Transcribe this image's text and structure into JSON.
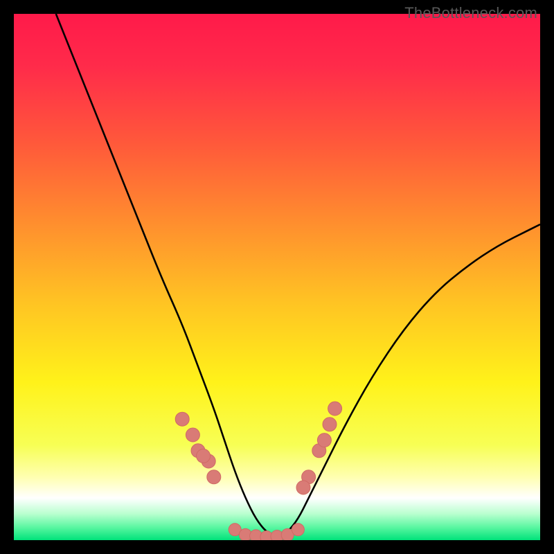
{
  "watermark": "TheBottleneck.com",
  "colors": {
    "gradient_stops": [
      {
        "offset": 0.0,
        "color": "#ff1a4a"
      },
      {
        "offset": 0.1,
        "color": "#ff2b4a"
      },
      {
        "offset": 0.25,
        "color": "#ff5a3a"
      },
      {
        "offset": 0.4,
        "color": "#ff8f2e"
      },
      {
        "offset": 0.55,
        "color": "#ffc423"
      },
      {
        "offset": 0.7,
        "color": "#fff21a"
      },
      {
        "offset": 0.82,
        "color": "#f7ff55"
      },
      {
        "offset": 0.88,
        "color": "#ffffb0"
      },
      {
        "offset": 0.92,
        "color": "#ffffff"
      },
      {
        "offset": 0.95,
        "color": "#b9ffcf"
      },
      {
        "offset": 0.975,
        "color": "#5cf7a2"
      },
      {
        "offset": 1.0,
        "color": "#00e27a"
      }
    ],
    "curve": "#000000",
    "marker_fill": "#d97b76",
    "marker_stroke": "#cf6a64"
  },
  "chart_data": {
    "type": "line",
    "title": "",
    "xlabel": "",
    "ylabel": "",
    "xlim": [
      0,
      100
    ],
    "ylim": [
      0,
      100
    ],
    "series": [
      {
        "name": "bottleneck-curve",
        "x": [
          8,
          12,
          16,
          20,
          24,
          28,
          32,
          35,
          38,
          40,
          42,
          44,
          46,
          48,
          50,
          52,
          54,
          56,
          59,
          63,
          68,
          74,
          80,
          86,
          92,
          98,
          100
        ],
        "y": [
          100,
          90,
          80,
          70,
          60,
          50,
          41,
          33,
          25,
          19,
          13,
          8,
          4,
          1.5,
          0.5,
          1.5,
          4,
          8,
          14,
          22,
          31,
          40,
          47,
          52,
          56,
          59,
          60
        ]
      }
    ],
    "markers": {
      "left": {
        "x": [
          32,
          35,
          37,
          34,
          36,
          38
        ],
        "y": [
          23,
          17,
          15,
          20,
          16,
          12
        ]
      },
      "right": {
        "x": [
          56,
          58,
          55,
          60,
          61,
          59
        ],
        "y": [
          12,
          17,
          10,
          22,
          25,
          19
        ]
      },
      "bottom": {
        "x": [
          42,
          44,
          46,
          48,
          50,
          52,
          54
        ],
        "y": [
          2,
          1,
          0.8,
          0.6,
          0.7,
          1,
          2
        ]
      }
    }
  }
}
